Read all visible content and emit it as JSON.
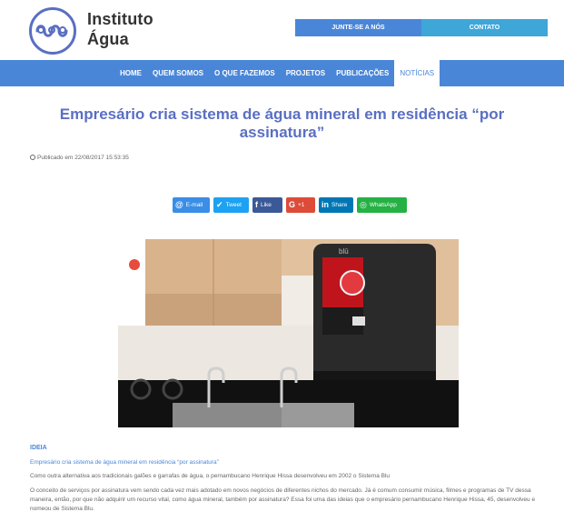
{
  "header": {
    "brand_line1": "Instituto",
    "brand_line2": "Água",
    "join_label": "JUNTE-SE A NÓS",
    "contact_label": "CONTATO"
  },
  "nav": {
    "items": [
      "HOME",
      "QUEM SOMOS",
      "O QUE FAZEMOS",
      "PROJETOS",
      "PUBLICAÇÕES",
      "NOTÍCIAS"
    ],
    "active": "NOTÍCIAS"
  },
  "article": {
    "title": "Empresário cria sistema de água mineral em residência “por assinatura”",
    "published": "Publicado em 22/08/2017 15:53:35",
    "tag": "IDEIA",
    "subtitle": "Empresário cria sistema de água mineral em residência “por assinatura”",
    "paragraph1": "Como outra alternativa aos tradicionais galões e garrafas de água, o pernambucano Henrique Hissa desenvolveu em 2002 o Sistema Blu",
    "paragraph2": "O conceito de serviços por assinatura vem sendo cada vez mais adotado em novos negócios de diferentes nichos do mercado. Já é comum consumir música, filmes e programas de TV dessa maneira, então, por que não adquirir um recurso vital, como água mineral, também por assinatura? Essa foi uma das ideias que o empresário pernambucano Henrique Hissa, 45, desenvolveu e nomeou de Sistema Blu."
  },
  "share": {
    "email": "E-mail",
    "tweet": "Tweet",
    "like": "Like",
    "gplus": "+1",
    "linkedin": "Share",
    "whatsapp": "WhatsApp"
  },
  "photo": {
    "device_brand": "blū"
  },
  "colors": {
    "primary": "#4a86d8",
    "title": "#5a6fc2",
    "contact": "#3fa6d8"
  }
}
